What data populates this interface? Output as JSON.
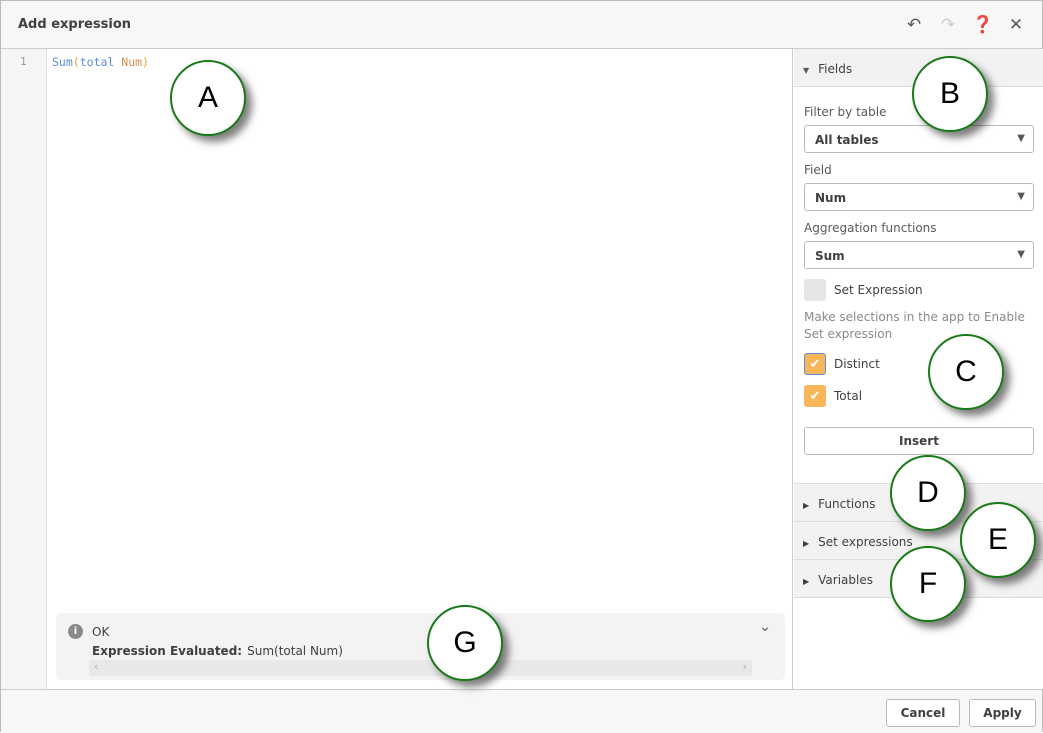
{
  "header": {
    "title": "Add expression",
    "icons": [
      "undo-icon",
      "redo-icon",
      "help-icon",
      "close-icon"
    ]
  },
  "editor": {
    "line_number": "1",
    "code": {
      "fn": "Sum",
      "open": "(",
      "kw": "total ",
      "field": "Num",
      "close": ")"
    }
  },
  "status": {
    "state": "OK",
    "evaluated_label": "Expression Evaluated:",
    "evaluated_value": "Sum(total Num)"
  },
  "sidebar": {
    "fields_title": "Fields",
    "filter_label": "Filter by table",
    "filter_value": "All tables",
    "field_label": "Field",
    "field_value": "Num",
    "agg_label": "Aggregation functions",
    "agg_value": "Sum",
    "set_expression_label": "Set Expression",
    "set_expression_checked": false,
    "hint": "Make selections in the app to Enable Set expression",
    "distinct_label": "Distinct",
    "distinct_checked": true,
    "total_label": "Total",
    "total_checked": true,
    "insert_label": "Insert",
    "sections": [
      "Functions",
      "Set expressions",
      "Variables"
    ]
  },
  "footer": {
    "cancel": "Cancel",
    "apply": "Apply"
  },
  "callouts": [
    "A",
    "B",
    "C",
    "D",
    "E",
    "F",
    "G"
  ],
  "colors": {
    "checkbox_on": "#f8b659",
    "callout_border": "#1a7a1a"
  }
}
